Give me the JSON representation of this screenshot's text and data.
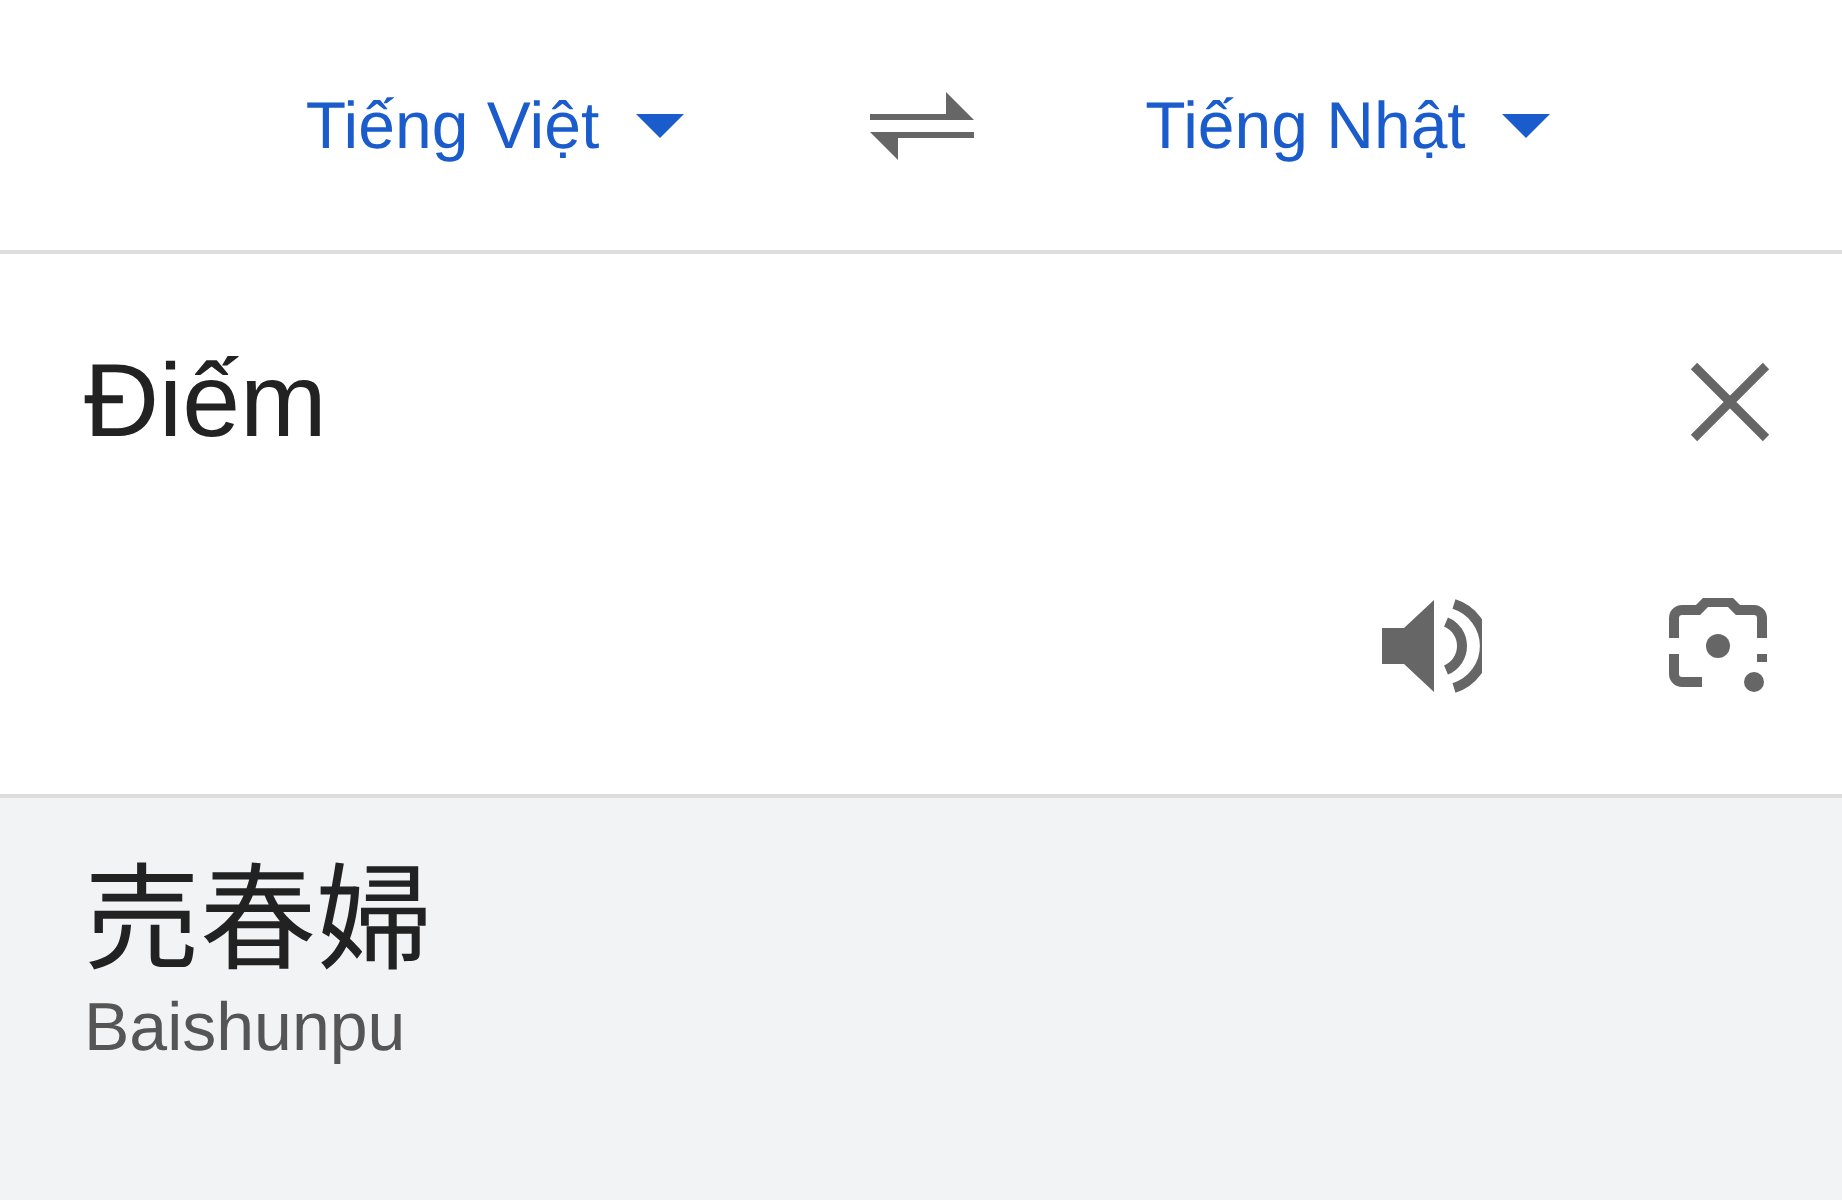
{
  "source_language": {
    "label": "Tiếng Việt"
  },
  "target_language": {
    "label": "Tiếng Nhật"
  },
  "input": {
    "value": "Điếm"
  },
  "translation": {
    "text": "売春婦",
    "romanization": "Baishunpu"
  }
}
